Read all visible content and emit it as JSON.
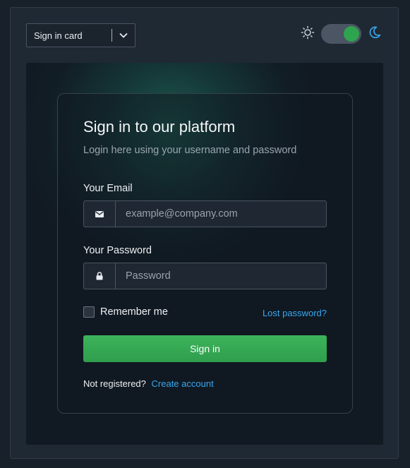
{
  "toolbar": {
    "variant_value": "Sign in card",
    "theme_mode": "dark",
    "accent_color": "#2ea44f",
    "link_color": "#38a8f0"
  },
  "card": {
    "title": "Sign in to our platform",
    "subtitle": "Login here using your username and password",
    "email_label": "Your Email",
    "email_placeholder": "example@company.com",
    "email_icon": "envelope-icon",
    "password_label": "Your Password",
    "password_placeholder": "Password",
    "password_icon": "lock-icon",
    "remember_label": "Remember me",
    "remember_checked": false,
    "lost_password": "Lost password?",
    "submit_label": "Sign in",
    "not_registered": "Not registered?",
    "create_account": "Create account"
  }
}
